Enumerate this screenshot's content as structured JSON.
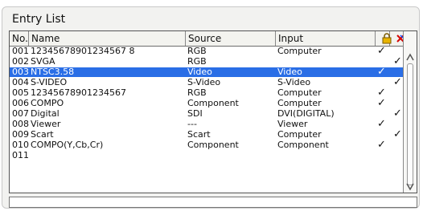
{
  "window": {
    "title": "Entry List"
  },
  "columns": {
    "no": "No.",
    "name": "Name",
    "source": "Source",
    "input": "Input"
  },
  "icons": {
    "lock": "lock-icon",
    "skip": "skip-icon"
  },
  "colors": {
    "selection": "#2a6ee6",
    "panel": "#f2f2f0"
  },
  "rows": [
    {
      "no": "001",
      "name": "12345678901234567 8",
      "source": "RGB",
      "input": "Computer",
      "lock": true,
      "skip": false
    },
    {
      "no": "002",
      "name": "SVGA",
      "source": "RGB",
      "input": "",
      "lock": false,
      "skip": true
    },
    {
      "no": "003",
      "name": "NTSC3.58",
      "source": "Video",
      "input": "Video",
      "lock": true,
      "skip": false,
      "selected": true
    },
    {
      "no": "004",
      "name": "S-VIDEO",
      "source": "S-Video",
      "input": "S-Video",
      "lock": false,
      "skip": true
    },
    {
      "no": "005",
      "name": "12345678901234567",
      "source": "RGB",
      "input": "Computer",
      "lock": true,
      "skip": false
    },
    {
      "no": "006",
      "name": "COMPO",
      "source": "Component",
      "input": "Computer",
      "lock": true,
      "skip": false
    },
    {
      "no": "007",
      "name": "Digital",
      "source": "SDI",
      "input": "DVI(DIGITAL)",
      "lock": false,
      "skip": true
    },
    {
      "no": "008",
      "name": "Viewer",
      "source": "---",
      "input": "Viewer",
      "lock": true,
      "skip": false
    },
    {
      "no": "009",
      "name": "Scart",
      "source": "Scart",
      "input": "Computer",
      "lock": false,
      "skip": true
    },
    {
      "no": "010",
      "name": "COMPO(Y,Cb,Cr)",
      "source": "Component",
      "input": "Component",
      "lock": true,
      "skip": false
    },
    {
      "no": "011",
      "name": "",
      "source": "",
      "input": "",
      "lock": false,
      "skip": false
    }
  ],
  "status": {
    "text": ""
  }
}
